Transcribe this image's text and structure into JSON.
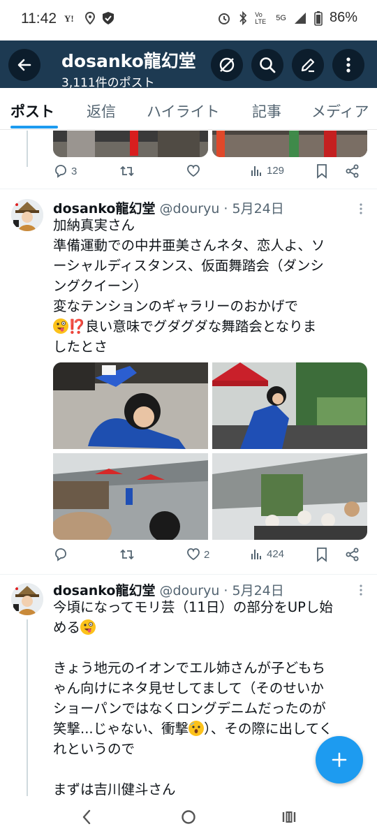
{
  "status_bar": {
    "time": "11:42",
    "battery": "86%",
    "network": "5G",
    "volte_label": "Vo LTE"
  },
  "header": {
    "title": "dosanko龍幻堂",
    "subtitle": "3,111件のポスト"
  },
  "tabs": [
    {
      "label": "ポスト",
      "active": true
    },
    {
      "label": "返信",
      "active": false
    },
    {
      "label": "ハイライト",
      "active": false
    },
    {
      "label": "記事",
      "active": false
    },
    {
      "label": "メディア",
      "active": false
    }
  ],
  "tweets": [
    {
      "stats": {
        "replies": "3",
        "retweets": "",
        "likes": "",
        "views": "129"
      }
    },
    {
      "author_name": "dosanko龍幻堂",
      "handle_date": "@douryu · 5月24日",
      "text_lines": [
        "加納真実さん",
        "準備運動での中井亜美さんネタ、恋人よ、ソ",
        "ーシャルディスタンス、仮面舞踏会（ダンシ",
        "ングクイーン）",
        "変なテンションのギャラリーのおかげで",
        "⁉️良い意味でグダグダな舞踏会となりま",
        "したとさ"
      ],
      "stats": {
        "replies": "",
        "retweets": "",
        "likes": "2",
        "views": "424"
      }
    },
    {
      "author_name": "dosanko龍幻堂",
      "handle_date": "@douryu · 5月24日",
      "text_lines": [
        "今頃になってモリ芸（11日）の部分をUPし始",
        "める",
        "",
        "きょう地元のイオンでエル姉さんが子どもち",
        "ゃん向けにネタ見せしてまして（そのせいか",
        "ショーパンではなくロングデニムだったのが",
        "笑撃...じゃない、衝撃",
        "れというので",
        "",
        "まずは吉川健斗さん"
      ],
      "line7_tail": "）、その際に出してく"
    }
  ],
  "icons": {
    "back": "arrow-left-icon",
    "grok": "grok-icon",
    "search": "search-icon",
    "edit": "pencil-icon",
    "more": "more-vertical-icon",
    "compose": "plus-icon"
  },
  "colors": {
    "header_bg": "#1d3a52",
    "accent": "#1d9bf0",
    "text_secondary": "#536471"
  }
}
